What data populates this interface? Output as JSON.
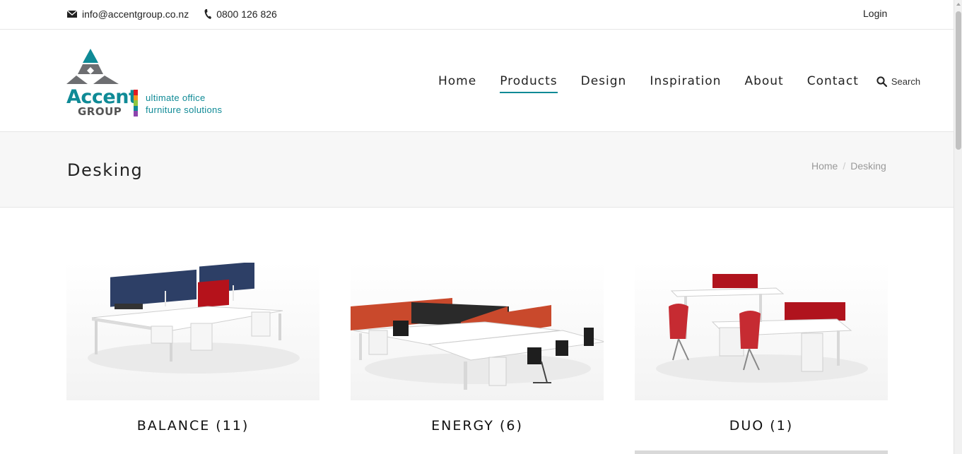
{
  "topbar": {
    "email": "info@accentgroup.co.nz",
    "phone": "0800 126 826",
    "login": "Login",
    "icons": {
      "email": "envelope-icon",
      "phone": "phone-icon"
    }
  },
  "logo": {
    "word_accent": "Accent",
    "word_group": "GROUP",
    "tagline_line1": "ultimate office",
    "tagline_line2": "furniture solutions",
    "colors": {
      "teal": "#0f8a96",
      "grey": "#6d6e71",
      "bars": [
        "#e31b23",
        "#f7941d",
        "#8dc63f",
        "#0f8a96",
        "#8e44ad"
      ]
    }
  },
  "nav": {
    "items": [
      {
        "label": "Home",
        "active": false
      },
      {
        "label": "Products",
        "active": true
      },
      {
        "label": "Design",
        "active": false
      },
      {
        "label": "Inspiration",
        "active": false
      },
      {
        "label": "About",
        "active": false
      },
      {
        "label": "Contact",
        "active": false
      }
    ],
    "search_label": "Search",
    "search_icon": "search-icon",
    "accent_color": "#0f8a96"
  },
  "page": {
    "title": "Desking",
    "breadcrumb": [
      {
        "label": "Home"
      },
      {
        "label": "Desking"
      }
    ]
  },
  "products": [
    {
      "label": "BALANCE (11)",
      "screen_color": "#2d3f66",
      "accent_color": "#b5121b"
    },
    {
      "label": "ENERGY (6)",
      "screen_color": "#c9492c",
      "accent_color": "#222222"
    },
    {
      "label": "DUO (1)",
      "screen_color": "#b0131d",
      "accent_color": "#c62b32"
    }
  ]
}
